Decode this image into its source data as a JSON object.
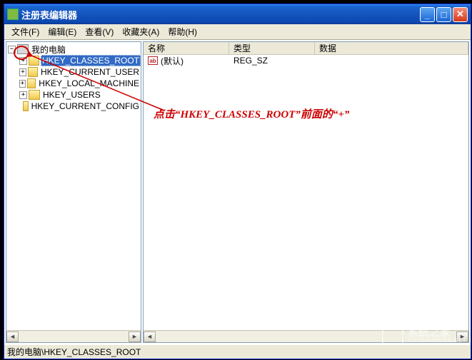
{
  "window": {
    "title": "注册表编辑器"
  },
  "menu": {
    "file": "文件(F)",
    "edit": "编辑(E)",
    "view": "查看(V)",
    "favorites": "收藏夹(A)",
    "help": "帮助(H)"
  },
  "tree": {
    "root": "我的电脑",
    "nodes": [
      {
        "label": "HKEY_CLASSES_ROOT",
        "expandable": true,
        "selected": true
      },
      {
        "label": "HKEY_CURRENT_USER",
        "expandable": true,
        "selected": false
      },
      {
        "label": "HKEY_LOCAL_MACHINE",
        "expandable": true,
        "selected": false
      },
      {
        "label": "HKEY_USERS",
        "expandable": true,
        "selected": false
      },
      {
        "label": "HKEY_CURRENT_CONFIG",
        "expandable": false,
        "selected": false
      }
    ]
  },
  "list": {
    "columns": {
      "name": "名称",
      "type": "类型",
      "data": "数据"
    },
    "rows": [
      {
        "name": "(默认)",
        "type": "REG_SZ",
        "data": ""
      }
    ]
  },
  "statusbar": "我的电脑\\HKEY_CLASSES_ROOT",
  "annotation": {
    "text": "点击“HKEY_CLASSES_ROOT”前面的“+”"
  },
  "watermark": {
    "cn": "系统之家",
    "en": "XITONGZHIJIA.NET"
  },
  "icons": {
    "collapse": "−",
    "expand": "+",
    "arrow_left": "◄",
    "arrow_right": "►",
    "ab": "ab"
  }
}
